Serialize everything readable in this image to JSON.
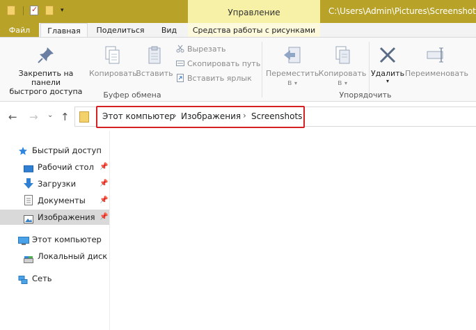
{
  "window": {
    "path": "C:\\Users\\Admin\\Pictures\\Screenshots",
    "context_header": "Управление"
  },
  "tabs": {
    "file": "Файл",
    "home": "Главная",
    "share": "Поделиться",
    "view": "Вид",
    "picture_tools": "Средства работы с рисунками"
  },
  "ribbon": {
    "pin_quick_access": [
      "Закрепить на панели",
      "быстрого доступа"
    ],
    "copy": "Копировать",
    "paste": "Вставить",
    "cut": "Вырезать",
    "copy_path": "Скопировать путь",
    "paste_shortcut": "Вставить ярлык",
    "clipboard_group": "Буфер обмена",
    "move_to": [
      "Переместить",
      "в"
    ],
    "copy_to": [
      "Копировать",
      "в"
    ],
    "delete": "Удалить",
    "rename": "Переименовать",
    "organize_group": "Упорядочить"
  },
  "breadcrumb": [
    "Этот компьютер",
    "Изображения",
    "Screenshots"
  ],
  "navpane": {
    "quick_access": "Быстрый доступ",
    "items": [
      {
        "label": "Рабочий стол",
        "icon": "desktop-icon"
      },
      {
        "label": "Загрузки",
        "icon": "download-icon"
      },
      {
        "label": "Документы",
        "icon": "documents-icon"
      },
      {
        "label": "Изображения",
        "icon": "pictures-icon"
      }
    ],
    "this_pc": "Этот компьютер",
    "local_disk": "Локальный диск (С",
    "network": "Сеть"
  },
  "colors": {
    "titlebar": "#b8a228",
    "context_tab": "#f7f1a7",
    "highlight": "#d42020",
    "selection": "#d9d9d9"
  }
}
